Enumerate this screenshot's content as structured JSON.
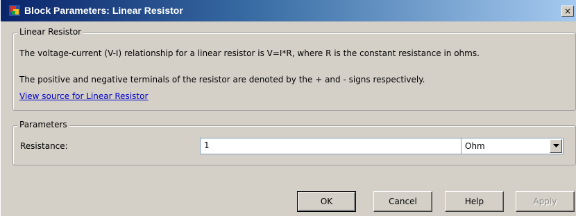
{
  "window": {
    "title": "Block Parameters: Linear Resistor",
    "close_glyph": "×",
    "app_icon": "simulink-block-icon"
  },
  "description": {
    "group_label": "Linear Resistor",
    "line1": "The voltage-current (V-I) relationship for a linear resistor is V=I*R, where R is the constant resistance in ohms.",
    "line2": "The positive and negative terminals of the resistor are denoted by the + and - signs respectively.",
    "source_link": "View source for Linear Resistor"
  },
  "parameters": {
    "group_label": "Parameters",
    "resistance_label": "Resistance:",
    "resistance_value": "1",
    "unit_value": "Ohm"
  },
  "buttons": {
    "ok": "OK",
    "cancel": "Cancel",
    "help": "Help",
    "apply": "Apply"
  }
}
